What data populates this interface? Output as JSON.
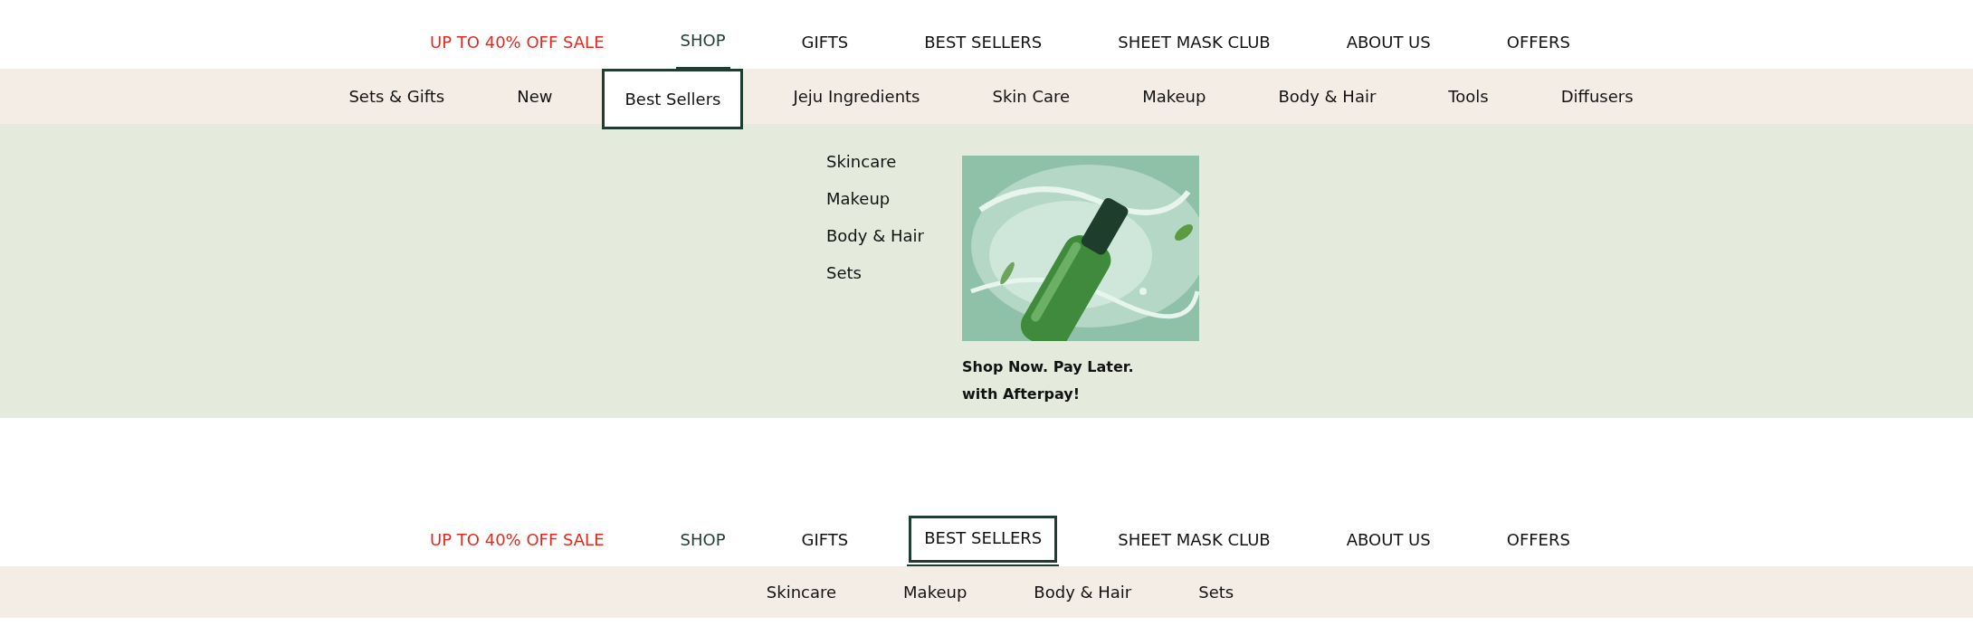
{
  "main_nav": [
    {
      "label": "UP TO 40% OFF SALE",
      "kind": "sale",
      "active": false,
      "selected": false,
      "focused": false
    },
    {
      "label": "SHOP",
      "kind": "link",
      "active": true,
      "selected": true,
      "focused": false
    },
    {
      "label": "GIFTS",
      "kind": "link",
      "active": false,
      "selected": false,
      "focused": false
    },
    {
      "label": "BEST SELLERS",
      "kind": "link",
      "active": false,
      "selected": false,
      "focused": false
    },
    {
      "label": "SHEET MASK CLUB",
      "kind": "link",
      "active": false,
      "selected": false,
      "focused": false
    },
    {
      "label": "ABOUT US",
      "kind": "link",
      "active": false,
      "selected": false,
      "focused": false
    },
    {
      "label": "OFFERS",
      "kind": "link",
      "active": false,
      "selected": false,
      "focused": false
    }
  ],
  "category_nav": [
    {
      "label": "Sets & Gifts",
      "focused": false
    },
    {
      "label": "New",
      "focused": false
    },
    {
      "label": "Best Sellers",
      "focused": true
    },
    {
      "label": "Jeju Ingredients",
      "focused": false
    },
    {
      "label": "Skin Care",
      "focused": false
    },
    {
      "label": "Makeup",
      "focused": false
    },
    {
      "label": "Body & Hair",
      "focused": false
    },
    {
      "label": "Tools",
      "focused": false
    },
    {
      "label": "Diffusers",
      "focused": false
    }
  ],
  "dropdown": {
    "links": [
      "Skincare",
      "Makeup",
      "Body & Hair",
      "Sets"
    ],
    "promo": {
      "kind": "picture",
      "caption": [
        "Shop Now. Pay Later.",
        "with Afterpay!"
      ]
    }
  },
  "second_view": {
    "main_nav": [
      {
        "label": "UP TO 40% OFF SALE",
        "kind": "sale",
        "active": false,
        "selected": false,
        "focused": false
      },
      {
        "label": "SHOP",
        "kind": "link",
        "active": true,
        "selected": false,
        "focused": false
      },
      {
        "label": "GIFTS",
        "kind": "link",
        "active": false,
        "selected": false,
        "focused": false
      },
      {
        "label": "BEST SELLERS",
        "kind": "link",
        "active": false,
        "selected": true,
        "focused": true
      },
      {
        "label": "SHEET MASK CLUB",
        "kind": "link",
        "active": false,
        "selected": false,
        "focused": false
      },
      {
        "label": "ABOUT US",
        "kind": "link",
        "active": false,
        "selected": false,
        "focused": false
      },
      {
        "label": "OFFERS",
        "kind": "link",
        "active": false,
        "selected": false,
        "focused": false
      }
    ],
    "sub_nav": [
      "Skincare",
      "Makeup",
      "Body & Hair",
      "Sets"
    ]
  }
}
